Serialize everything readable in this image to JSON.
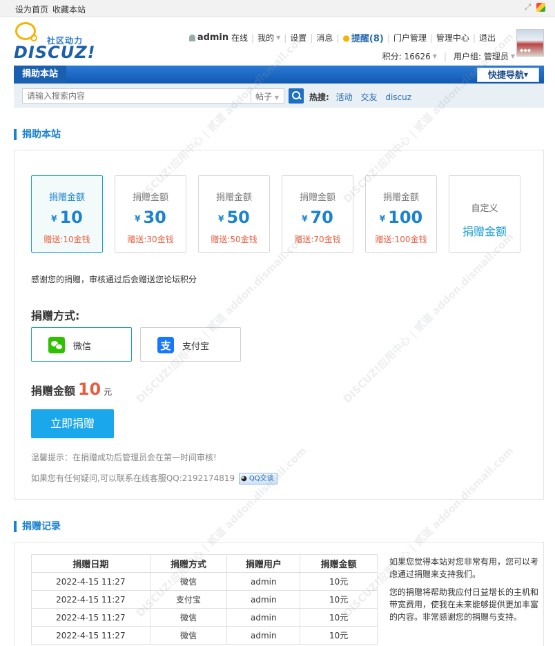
{
  "topbar": {
    "set_home": "设为首页",
    "bookmark": "收藏本站"
  },
  "logo": {
    "subtitle": "社区动力",
    "brand": "DISCUZ!"
  },
  "usernav": {
    "username": "admin",
    "online": "在线",
    "mine": "我的",
    "settings": "设置",
    "messages": "消息",
    "remind": "提醒(8)",
    "portal_manage": "门户管理",
    "admin_center": "管理中心",
    "logout": "退出",
    "points": "积分: 16626",
    "usergroup": "用户组: 管理员"
  },
  "navbar": {
    "current": "捐助本站",
    "quick_nav": "快捷导航"
  },
  "search": {
    "placeholder": "请输入搜索内容",
    "type": "帖子",
    "hot_label": "热搜:",
    "keywords": [
      "活动",
      "交友",
      "discuz"
    ]
  },
  "donate": {
    "section_title": "捐助本站",
    "amount_label": "捐赠金额",
    "currency": "¥",
    "amounts": [
      {
        "value": "10",
        "gift": "赠送:10金钱"
      },
      {
        "value": "30",
        "gift": "赠送:30金钱"
      },
      {
        "value": "50",
        "gift": "赠送:50金钱"
      },
      {
        "value": "70",
        "gift": "赠送:70金钱"
      },
      {
        "value": "100",
        "gift": "赠送:100金钱"
      }
    ],
    "custom_line1": "自定义",
    "custom_line2": "捐赠金额",
    "thanks_note": "感谢您的捐赠，审核通过后会赠送您论坛积分",
    "method_title": "捐赠方式:",
    "methods": [
      "微信",
      "支付宝"
    ],
    "total_label": "捐赠金额",
    "total_value": "10",
    "total_unit": "元",
    "submit": "立即捐赠",
    "tip": "温馨提示：在捐赠成功后管理员会在第一时间审核!",
    "contact": "如果您有任何疑问,可以联系在线客服QQ:2192174819",
    "qq_badge": "QQ交谈"
  },
  "records": {
    "section_title": "捐赠记录",
    "columns": [
      "捐赠日期",
      "捐赠方式",
      "捐赠用户",
      "捐赠金额"
    ],
    "rows": [
      [
        "2022-4-15 11:27",
        "微信",
        "admin",
        "10元"
      ],
      [
        "2022-4-15 11:27",
        "支付宝",
        "admin",
        "10元"
      ],
      [
        "2022-4-15 11:27",
        "微信",
        "admin",
        "10元"
      ],
      [
        "2022-4-15 11:27",
        "微信",
        "admin",
        "10元"
      ]
    ],
    "side_para1": "如果您觉得本站对您非常有用，您可以考虑通过捐赠来支持我们。",
    "side_para2": "您的捐赠将帮助我应付日益增长的主机和带宽费用，使我在未来能够提供更加丰富的内容。非常感谢您的捐赠与支持。"
  },
  "watermark": "DISCUZ!应用中心 | 贰道 addon.dismall.com",
  "colors": {
    "accent": "#1b82d1",
    "button": "#1ba7ec",
    "gift": "#e85d3f",
    "nav": "#1059b3"
  }
}
